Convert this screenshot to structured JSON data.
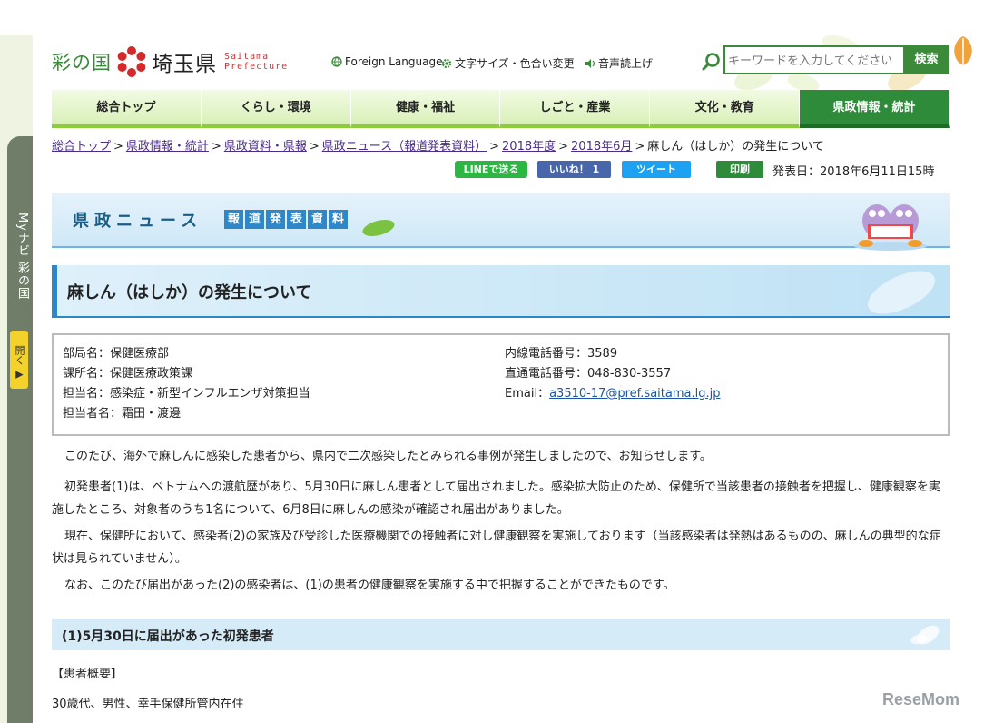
{
  "sidebar": {
    "mynavi_label": "Myナビ 彩の国",
    "open_label": "開く ▶"
  },
  "header": {
    "logo_saino": "彩の国",
    "logo_ken": "埼玉県",
    "logo_en_1": "Saitama",
    "logo_en_2": "Prefecture",
    "foreign_language": "Foreign Language",
    "font_color_change": "文字サイズ・色合い変更",
    "text_to_speech": "音声読上げ",
    "search_placeholder": "キーワードを入力してください",
    "search_button": "検索"
  },
  "nav": {
    "items": [
      {
        "label": "総合トップ"
      },
      {
        "label": "くらし・環境"
      },
      {
        "label": "健康・福祉"
      },
      {
        "label": "しごと・産業"
      },
      {
        "label": "文化・教育"
      },
      {
        "label": "県政情報・統計"
      }
    ]
  },
  "breadcrumb": {
    "items": [
      "総合トップ",
      "県政情報・統計",
      "県政資料・県報",
      "県政ニュース（報道発表資料）",
      "2018年度",
      "2018年6月"
    ],
    "current": "麻しん（はしか）の発生について",
    "separator": ">"
  },
  "social": {
    "line": "LINEで送る",
    "facebook": "いいね！ 1",
    "twitter": "ツイート",
    "print": "印刷",
    "pubdate": "発表日：2018年6月11日15時"
  },
  "banner": {
    "title": "県政ニュース",
    "sub_chars": [
      "報",
      "道",
      "発",
      "表",
      "資",
      "料"
    ]
  },
  "article": {
    "title": "麻しん（はしか）の発生について",
    "contact": {
      "dept": "部局名：保健医療部",
      "section": "課所名：保健医療政策課",
      "charge": "担当名：感染症・新型インフルエンザ対策担当",
      "person": "担当者名：霜田・渡邊",
      "ext": "内線電話番号：3589",
      "direct": "直通電話番号：048-830-3557",
      "email_label": "Email：",
      "email": "a3510-17@pref.saitama.lg.jp"
    },
    "paragraphs": [
      "このたび、海外で麻しんに感染した患者から、県内で二次感染したとみられる事例が発生しましたので、お知らせします。",
      "初発患者(1)は、ベトナムへの渡航歴があり、5月30日に麻しん患者として届出されました。感染拡大防止のため、保健所で当該患者の接触者を把握し、健康観察を実施したところ、対象者のうち1名について、6月8日に麻しんの感染が確認され届出がありました。",
      "現在、保健所において、感染者(2)の家族及び受診した医療機関での接触者に対し健康観察を実施しております（当該感染者は発熱はあるものの、麻しんの典型的な症状は見られていません）。",
      "なお、このたび届出があった(2)の感染者は、(1)の患者の健康観察を実施する中で把握することができたものです。"
    ],
    "subhead": "(1)5月30日に届出があった初発患者",
    "overview_label": "【患者概要】",
    "patient_info": "30歳代、男性、幸手保健所管内在住"
  },
  "watermark": "ReseMom",
  "colors": {
    "brand_green": "#2e8b3a",
    "link_purple": "#4b2c8a",
    "banner_blue": "#2d87c8"
  }
}
